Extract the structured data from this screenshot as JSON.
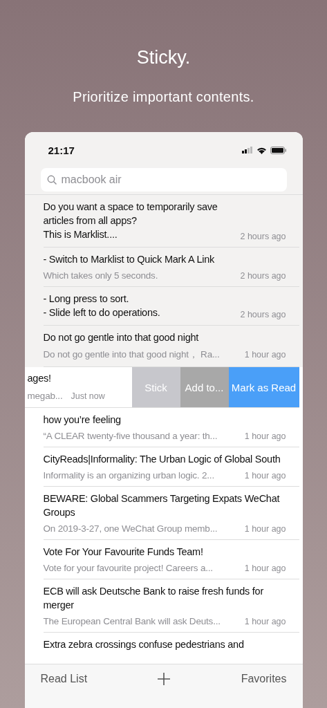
{
  "headline": "Sticky.",
  "tagline": "Prioritize important contents.",
  "status_bar": {
    "time": "21:17"
  },
  "search": {
    "value": "macbook air"
  },
  "rows": [
    {
      "kind": "normal",
      "sticky": true,
      "title": "Do you want a space to temporarily save articles from all apps?\nThis is Marklist....",
      "time": "2 hours ago"
    },
    {
      "kind": "normal",
      "sticky": true,
      "title": "- Switch to Marklist to Quick Mark A Link",
      "subtitle": "Which takes only 5 seconds.",
      "time": "2 hours ago"
    },
    {
      "kind": "normal",
      "sticky": true,
      "title": "- Long press to sort.\n- Slide left to do operations.",
      "time": "2 hours ago"
    },
    {
      "kind": "normal",
      "sticky": true,
      "title": "Do not go gentle into that good night",
      "subtitle": "Do not go gentle into that good night，  Ra...",
      "time": "1 hour ago"
    },
    {
      "kind": "swiped",
      "sticky": false,
      "title": "ages!",
      "subtitle": "megab...",
      "time": "Just now",
      "actions": [
        {
          "label": "Stick",
          "kind": "stick"
        },
        {
          "label": "Add to...",
          "kind": "add"
        },
        {
          "label": "Mark as Read",
          "kind": "read"
        }
      ]
    },
    {
      "kind": "normal",
      "sticky": false,
      "title": "how you’re feeling",
      "subtitle": "“A CLEAR twenty-five thousand a year: th...",
      "time": "1 hour ago"
    },
    {
      "kind": "normal",
      "sticky": false,
      "title": "CityReads|Informality: The Urban Logic of Global South",
      "subtitle": "Informality is an organizing urban logic. 2...",
      "time": "1 hour ago"
    },
    {
      "kind": "normal",
      "sticky": false,
      "title": "BEWARE: Global Scammers Targeting Expats WeChat Groups",
      "subtitle": "On 2019-3-27, one WeChat Group memb...",
      "time": "1 hour ago"
    },
    {
      "kind": "normal",
      "sticky": false,
      "title": "Vote For Your Favourite Funds Team!",
      "subtitle": "Vote for your favourite project! Careers a...",
      "time": "1 hour ago"
    },
    {
      "kind": "normal",
      "sticky": false,
      "title": "ECB will ask Deutsche Bank to raise fresh funds for merger",
      "subtitle": "The European Central Bank will ask Deuts...",
      "time": "1 hour ago"
    },
    {
      "kind": "cut",
      "sticky": false,
      "title": "Extra zebra crossings confuse pedestrians and"
    }
  ],
  "tab_bar": {
    "left": "Read List",
    "right": "Favorites"
  }
}
